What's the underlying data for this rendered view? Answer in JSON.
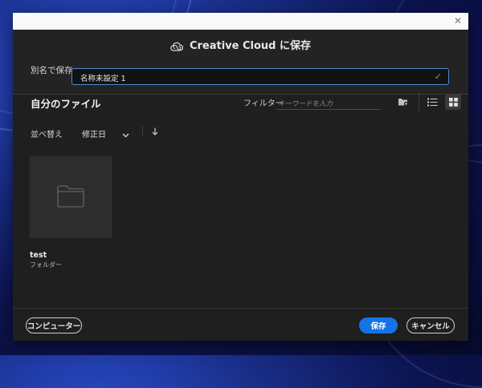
{
  "dialog": {
    "title": "Creative Cloud に保存",
    "save_as_label": "別名で保存",
    "filename_value": "名称未設定 1"
  },
  "browser": {
    "section_title": "自分のファイル",
    "filter_label": "フィルター",
    "filter_placeholder": "キーワードを入力",
    "sort_label": "並べ替え",
    "sort_field": "修正日",
    "sort_direction_icon": "arrow-down-icon"
  },
  "items": [
    {
      "name": "test",
      "type": "フォルダー",
      "icon": "folder-icon"
    }
  ],
  "footer": {
    "computer_button": "コンピューター",
    "save_button": "保存",
    "cancel_button": "キャンセル"
  },
  "colors": {
    "accent": "#1473e6",
    "check": "#4fb36a",
    "dialog_bg": "#1f1f1f"
  }
}
